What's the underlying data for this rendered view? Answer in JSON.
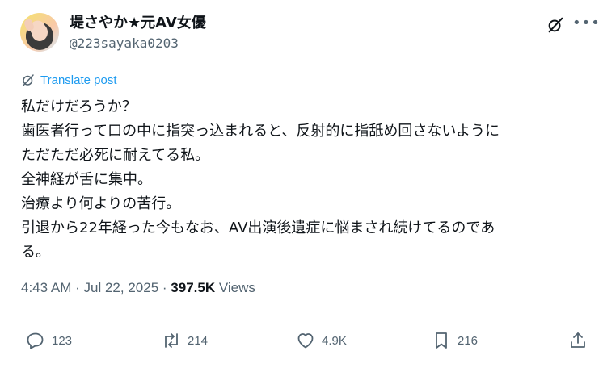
{
  "author": {
    "display_name": "堤さやか★元AV女優",
    "handle": "@223sayaka0203"
  },
  "translate_label": "Translate post",
  "body_lines": [
    "私だけだろうか？",
    "歯医者行って口の中に指突っ込まれると、反射的に指舐め回さないように",
    "ただただ必死に耐えてる私。",
    "全神経が舌に集中。",
    "治療より何よりの苦行。",
    "引退から22年経った今もなお、AV出演後遺症に悩まされ続けてるのであ",
    "る。"
  ],
  "meta": {
    "time": "4:43 AM",
    "separator": "·",
    "date": "Jul 22, 2025",
    "views_count": "397.5K",
    "views_label": "Views"
  },
  "actions": {
    "reply_count": "123",
    "retweet_count": "214",
    "like_count": "4.9K",
    "bookmark_count": "216"
  },
  "icons": {
    "grok": "grok-icon",
    "more": "more-icon",
    "translate": "translate-icon",
    "reply": "reply-icon",
    "retweet": "retweet-icon",
    "like": "heart-icon",
    "bookmark": "bookmark-icon",
    "share": "share-icon"
  },
  "colors": {
    "accent": "#1d9bf0",
    "text_primary": "#0f1419",
    "text_secondary": "#536471"
  }
}
